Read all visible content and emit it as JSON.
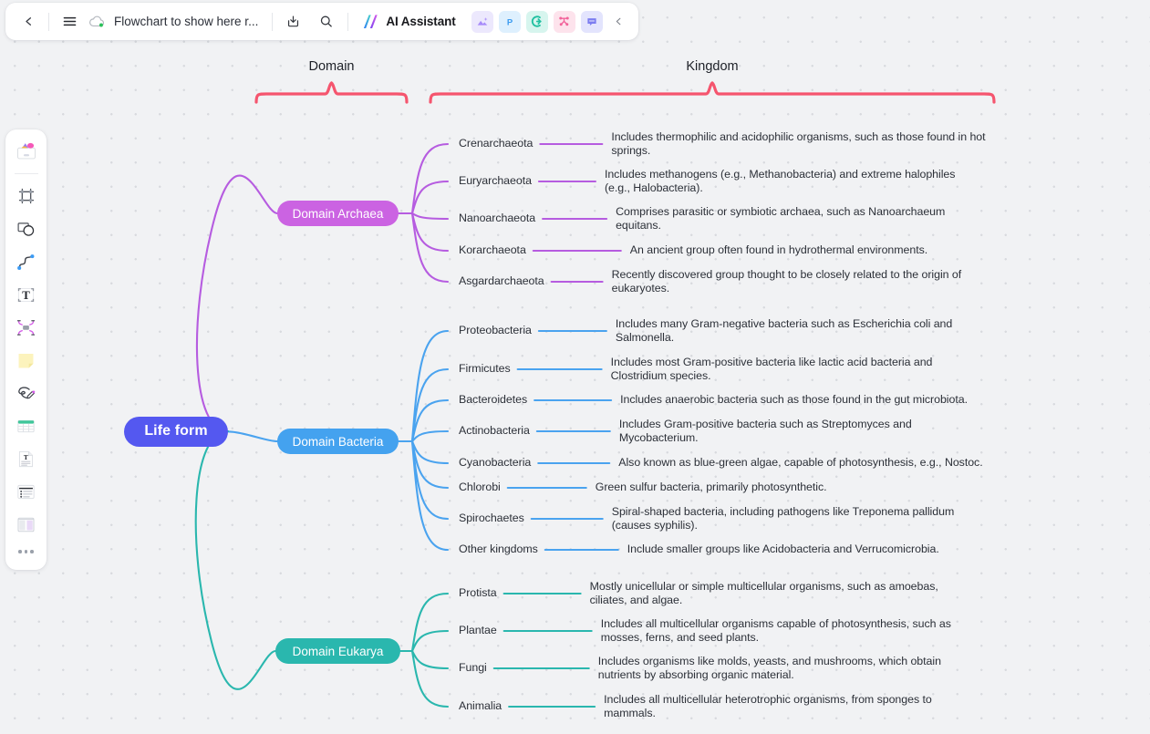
{
  "topbar": {
    "back_icon": "chevron-left-icon",
    "menu_icon": "hamburger-menu-icon",
    "cloud_icon": "cloud-saved-icon",
    "doc_title": "Flowchart to show here r...",
    "download_icon": "download-icon",
    "search_icon": "search-icon",
    "ai_assistant_label": "AI Assistant",
    "ai_logo_icon": "ai-sparkle-logo-icon",
    "apps": [
      {
        "name": "image-app-icon",
        "glyph": "image",
        "bg": "#ece8fd",
        "fg": "#a78bfa"
      },
      {
        "name": "presentation-app-icon",
        "glyph": "P",
        "bg": "#def0fe",
        "fg": "#3b9bf0"
      },
      {
        "name": "mindmap-app-icon",
        "glyph": "C",
        "bg": "#d7f5ee",
        "fg": "#1fc0a0"
      },
      {
        "name": "network-app-icon",
        "glyph": "node",
        "bg": "#fde3ec",
        "fg": "#f2639a"
      },
      {
        "name": "comment-app-icon",
        "glyph": "chat",
        "bg": "#e3e4fd",
        "fg": "#7c7df0"
      }
    ],
    "collapse_icon": "chevron-left-icon"
  },
  "rail": {
    "items": [
      {
        "name": "shapes-library-icon",
        "label": "Shapes"
      },
      {
        "name": "frame-tool-icon",
        "label": "Frame"
      },
      {
        "name": "shape-tool-icon",
        "label": "Shape"
      },
      {
        "name": "connector-tool-icon",
        "label": "Connector"
      },
      {
        "name": "text-tool-icon",
        "label": "Text"
      },
      {
        "name": "container-tool-icon",
        "label": "Container"
      },
      {
        "name": "sticky-note-tool-icon",
        "label": "Sticky note"
      },
      {
        "name": "pen-tool-icon",
        "label": "Pen"
      },
      {
        "name": "table-tool-icon",
        "label": "Table"
      },
      {
        "name": "document-tool-icon",
        "label": "Document"
      },
      {
        "name": "list-tool-icon",
        "label": "List"
      },
      {
        "name": "layout-tool-icon",
        "label": "Layout"
      }
    ],
    "more_icon": "more-options-icon"
  },
  "braces": {
    "domain_label": "Domain",
    "kingdom_label": "Kingdom",
    "color": "#f5556e"
  },
  "colors": {
    "root": "#5458f0",
    "archaea": "#cb63e2",
    "archaea_line": "#b65ce0",
    "bacteria": "#44a2ef",
    "bacteria_line": "#4aa3ef",
    "eukarya": "#2ab7ae",
    "eukarya_line": "#2ab7ae",
    "canvas_bg": "#f1f2f4"
  },
  "mindmap": {
    "root": "Life form",
    "branches": [
      {
        "id": "archaea",
        "label": "Domain Archaea",
        "children": [
          {
            "label": "Crenarchaeota",
            "desc": "Includes thermophilic and acidophilic organisms, such as those found in hot springs."
          },
          {
            "label": "Euryarchaeota",
            "desc": "Includes methanogens (e.g., Methanobacteria) and extreme halophiles (e.g., Halobacteria)."
          },
          {
            "label": "Nanoarchaeota",
            "desc": "Comprises parasitic or symbiotic archaea, such as Nanoarchaeum equitans."
          },
          {
            "label": "Korarchaeota",
            "desc": "An ancient group often found in hydrothermal environments."
          },
          {
            "label": "Asgardarchaeota",
            "desc": "Recently discovered group thought to be closely related to the origin of eukaryotes."
          }
        ]
      },
      {
        "id": "bacteria",
        "label": "Domain Bacteria",
        "children": [
          {
            "label": "Proteobacteria",
            "desc": "Includes many Gram-negative bacteria such as Escherichia coli and Salmonella."
          },
          {
            "label": "Firmicutes",
            "desc": "Includes most Gram-positive bacteria like lactic acid bacteria and Clostridium species."
          },
          {
            "label": "Bacteroidetes",
            "desc": "Includes anaerobic bacteria such as those found in the gut microbiota."
          },
          {
            "label": "Actinobacteria",
            "desc": "Includes Gram-positive bacteria such as Streptomyces and Mycobacterium."
          },
          {
            "label": "Cyanobacteria",
            "desc": "Also known as blue-green algae, capable of photosynthesis, e.g., Nostoc."
          },
          {
            "label": "Chlorobi",
            "desc": "Green sulfur bacteria, primarily photosynthetic."
          },
          {
            "label": "Spirochaetes",
            "desc": "Spiral-shaped bacteria, including pathogens like Treponema pallidum (causes syphilis)."
          },
          {
            "label": "Other kingdoms",
            "desc": "Include smaller groups like Acidobacteria and Verrucomicrobia."
          }
        ]
      },
      {
        "id": "eukarya",
        "label": "Domain Eukarya",
        "children": [
          {
            "label": "Protista",
            "desc": "Mostly unicellular or simple multicellular organisms, such as amoebas, ciliates, and algae."
          },
          {
            "label": "Plantae",
            "desc": "Includes all multicellular organisms capable of photosynthesis, such as mosses, ferns, and seed plants."
          },
          {
            "label": "Fungi",
            "desc": "Includes organisms like molds, yeasts, and mushrooms, which obtain nutrients by absorbing organic material."
          },
          {
            "label": "Animalia",
            "desc": "Includes all multicellular heterotrophic organisms, from sponges to mammals."
          }
        ]
      }
    ]
  }
}
